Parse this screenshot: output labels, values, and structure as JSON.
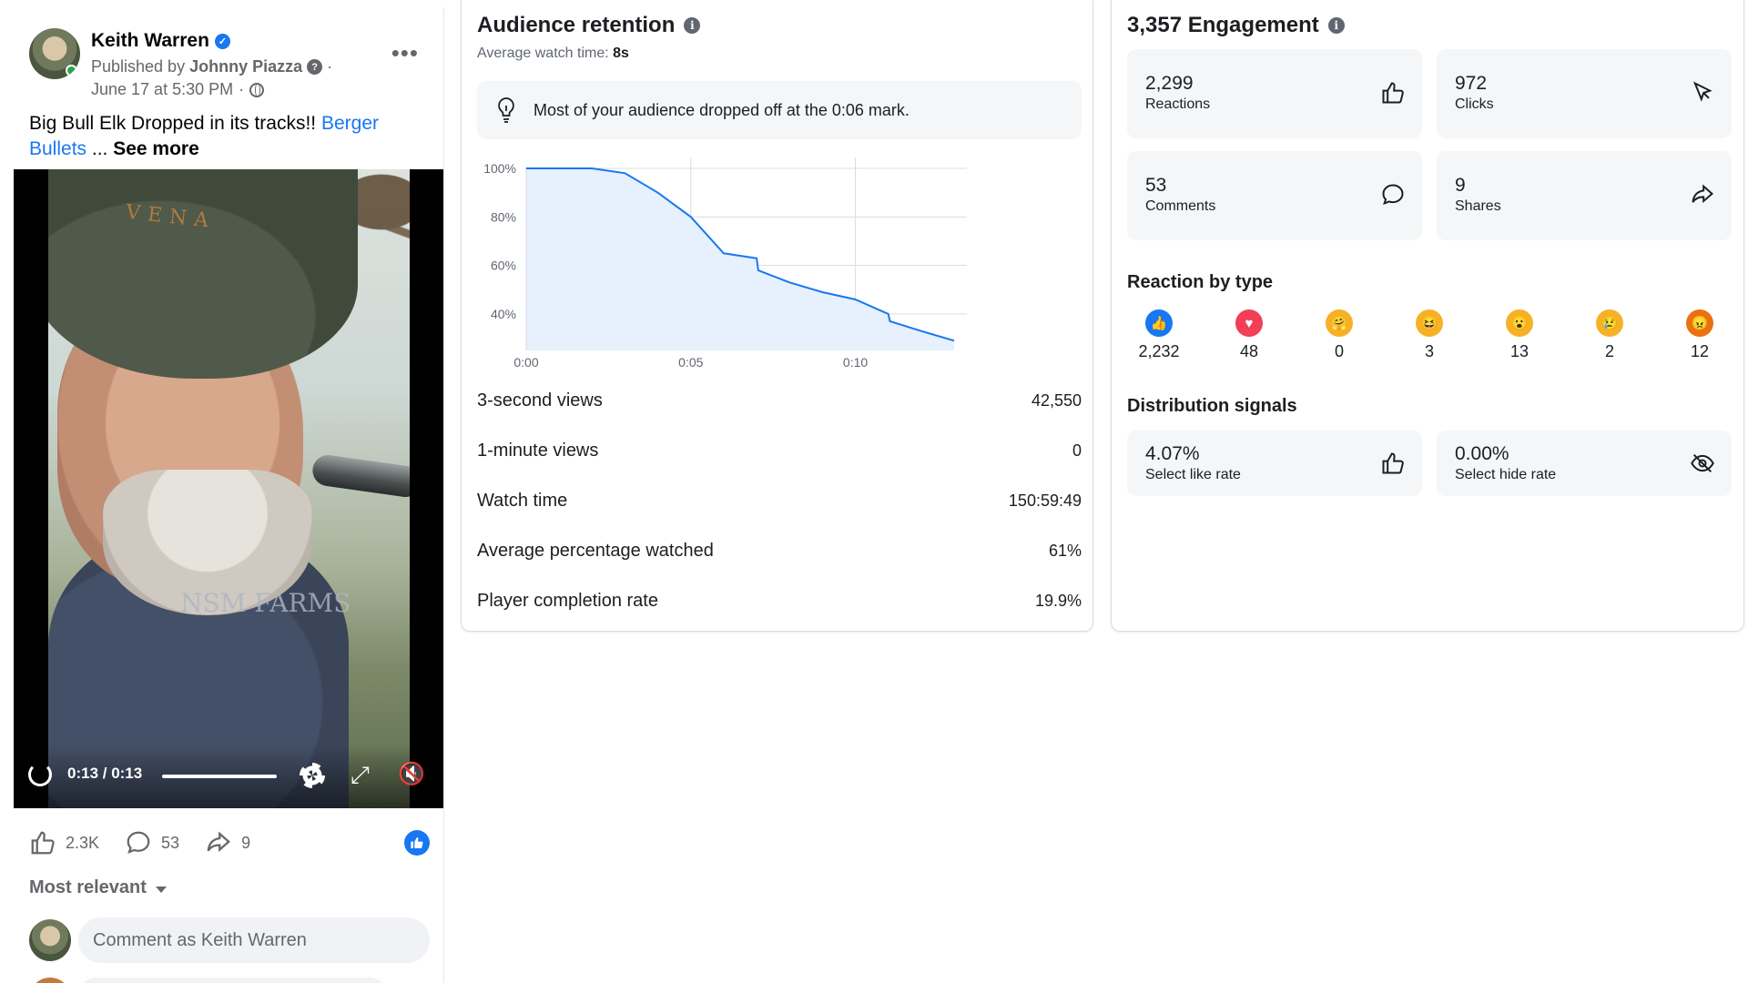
{
  "post": {
    "author": "Keith Warren",
    "published_prefix": "Published by",
    "publisher": "Johnny Piazza",
    "date": "June 17 at 5:30 PM",
    "text": "Big Bull Elk Dropped in its tracks!!",
    "tag": "Berger Bullets",
    "ellipsis": "...",
    "see_more": "See more",
    "video_time": "0:13 / 0:13",
    "video_progress": 1.0,
    "likes": "2.3K",
    "comments": "53",
    "shares": "9",
    "sort_label": "Most relevant",
    "comment_placeholder": "Comment as Keith Warren",
    "cap_logo": "VENA",
    "shirt_logo": "NSM FARMS"
  },
  "retention": {
    "title": "Audience retention",
    "avg_label": "Average watch time:",
    "avg_value": "8s",
    "insight": "Most of your audience dropped off at the 0:06 mark.",
    "metrics": [
      {
        "label": "3-second views",
        "value": "42,550"
      },
      {
        "label": "1-minute views",
        "value": "0"
      },
      {
        "label": "Watch time",
        "value": "150:59:49"
      },
      {
        "label": "Average percentage watched",
        "value": "61%"
      },
      {
        "label": "Player completion rate",
        "value": "19.9%"
      }
    ]
  },
  "chart_data": {
    "type": "area",
    "title": "",
    "xlabel": "",
    "ylabel": "",
    "x_ticks": [
      "0:00",
      "0:05",
      "0:10"
    ],
    "y_ticks": [
      "100%",
      "80%",
      "60%",
      "40%"
    ],
    "xlim": [
      0,
      13
    ],
    "ylim": [
      25,
      100
    ],
    "grid": true,
    "series": [
      {
        "x": [
          0,
          2,
          3,
          4,
          5,
          6,
          7,
          7.05,
          8,
          9,
          10,
          11,
          11.05,
          12,
          13
        ],
        "y": [
          100,
          100,
          98,
          90,
          80,
          65,
          63,
          58,
          53,
          49,
          46,
          40,
          37,
          33,
          29
        ]
      }
    ],
    "color": "#1877f2",
    "fill": "#e7f0fd"
  },
  "engagement": {
    "title": "3,357 Engagement",
    "cards": [
      {
        "value": "2,299",
        "label": "Reactions",
        "icon": "thumbs-up-icon"
      },
      {
        "value": "972",
        "label": "Clicks",
        "icon": "cursor-icon"
      },
      {
        "value": "53",
        "label": "Comments",
        "icon": "comment-icon"
      },
      {
        "value": "9",
        "label": "Shares",
        "icon": "share-icon"
      }
    ],
    "reaction_title": "Reaction by type",
    "reactions": [
      {
        "type": "like",
        "count": "2,232",
        "color": "#1877f2"
      },
      {
        "type": "love",
        "count": "48",
        "color": "#f33e58"
      },
      {
        "type": "care",
        "count": "0",
        "color": "#f7b125"
      },
      {
        "type": "haha",
        "count": "3",
        "color": "#f7b125"
      },
      {
        "type": "wow",
        "count": "13",
        "color": "#f7b125"
      },
      {
        "type": "sad",
        "count": "2",
        "color": "#f7b125"
      },
      {
        "type": "angry",
        "count": "12",
        "color": "#e9710f"
      }
    ],
    "distribution_title": "Distribution signals",
    "distribution": [
      {
        "value": "4.07%",
        "label": "Select like rate",
        "icon": "thumbs-up-icon"
      },
      {
        "value": "0.00%",
        "label": "Select hide rate",
        "icon": "eye-off-icon"
      }
    ]
  }
}
